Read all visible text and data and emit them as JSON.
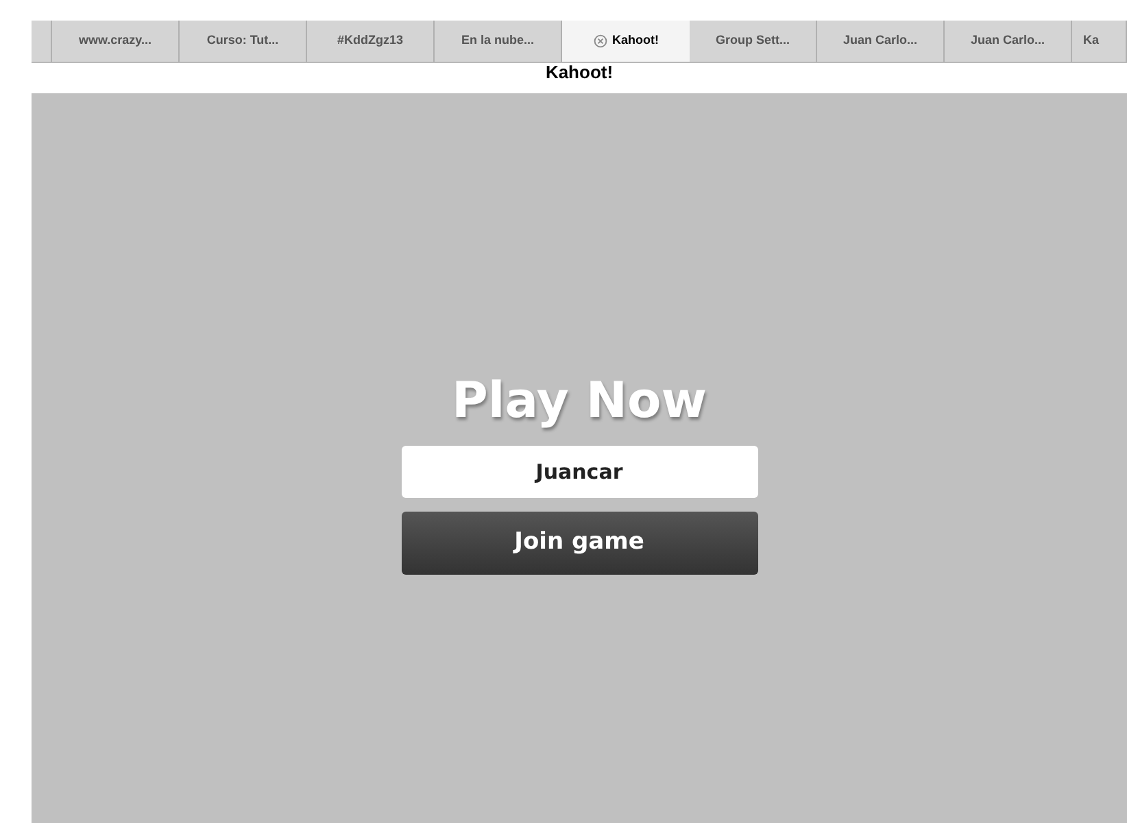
{
  "tabs": [
    {
      "selected": false,
      "closable": false
    },
    {
      "label": "www.crazy...",
      "selected": false,
      "closable": false
    },
    {
      "label": "Curso: Tut...",
      "selected": false,
      "closable": false
    },
    {
      "label": "#KddZgz13",
      "selected": false,
      "closable": false
    },
    {
      "label": "En la nube...",
      "selected": false,
      "closable": false
    },
    {
      "label": "Kahoot!",
      "selected": true,
      "closable": true
    },
    {
      "label": "Group Sett...",
      "selected": false,
      "closable": false
    },
    {
      "label": "Juan Carlo...",
      "selected": false,
      "closable": false
    },
    {
      "label": "Juan Carlo...",
      "selected": false,
      "closable": false
    },
    {
      "label": "Ka",
      "selected": false,
      "closable": false
    }
  ],
  "page": {
    "title": "Kahoot!",
    "heading": "Play Now",
    "nickname": {
      "value": "Juancar"
    },
    "button": "Join game"
  }
}
